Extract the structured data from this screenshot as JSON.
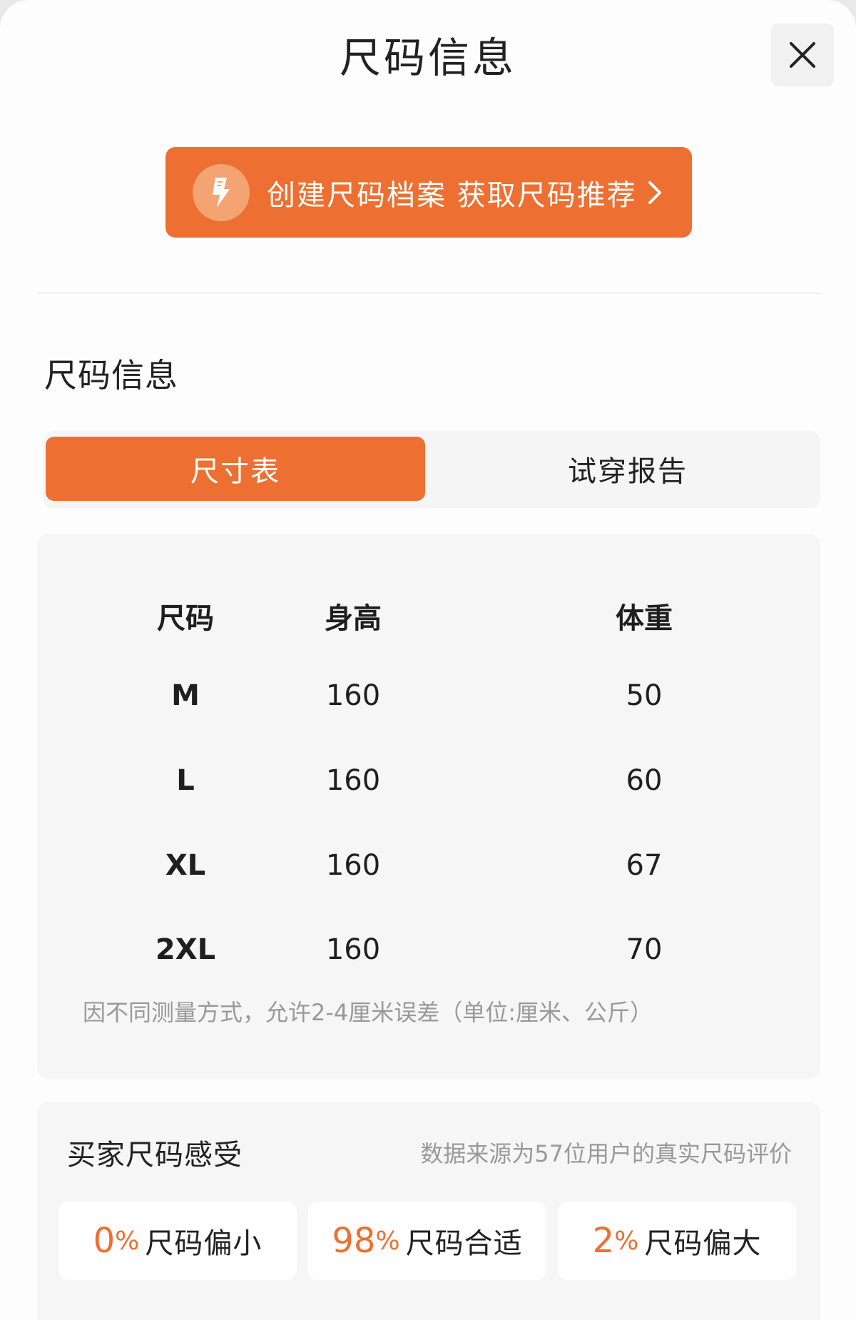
{
  "header": {
    "title": "尺码信息",
    "close_icon": "close-icon"
  },
  "cta": {
    "icon": "ruler-icon",
    "label": "创建尺码档案 获取尺码推荐",
    "arrow_icon": "chevron-right-icon"
  },
  "section": {
    "title": "尺码信息"
  },
  "tabs": [
    {
      "label": "尺寸表",
      "active": true
    },
    {
      "label": "试穿报告",
      "active": false
    }
  ],
  "size_table": {
    "headers": [
      "尺码",
      "身高",
      "体重"
    ],
    "rows": [
      [
        "M",
        "160",
        "50"
      ],
      [
        "L",
        "160",
        "60"
      ],
      [
        "XL",
        "160",
        "67"
      ],
      [
        "2XL",
        "160",
        "70"
      ]
    ],
    "note": "因不同测量方式，允许2-4厘米误差（单位:厘米、公斤）"
  },
  "feel": {
    "title": "买家尺码感受",
    "source": "数据来源为57位用户的真实尺码评价",
    "items": [
      {
        "percent": "0",
        "unit": "%",
        "label": "尺码偏小"
      },
      {
        "percent": "98",
        "unit": "%",
        "label": "尺码合适"
      },
      {
        "percent": "2",
        "unit": "%",
        "label": "尺码偏大"
      }
    ]
  },
  "colors": {
    "accent": "#ed6f31",
    "muted": "#999999",
    "card": "#f6f6f6"
  }
}
